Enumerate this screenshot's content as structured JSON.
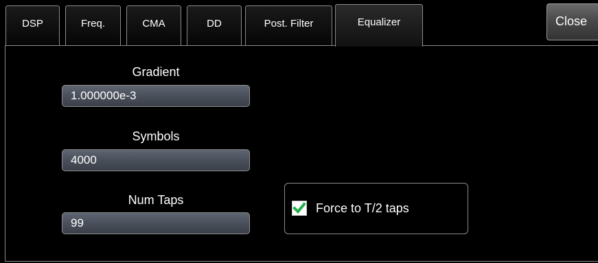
{
  "tabs": [
    {
      "label": "DSP"
    },
    {
      "label": "Freq."
    },
    {
      "label": "CMA"
    },
    {
      "label": "DD"
    },
    {
      "label": "Post. Filter"
    },
    {
      "label": "Equalizer",
      "active": true
    }
  ],
  "close_label": "Close",
  "fields": {
    "gradient": {
      "label": "Gradient",
      "value": "1.000000e-3"
    },
    "symbols": {
      "label": "Symbols",
      "value": "4000"
    },
    "num_taps": {
      "label": "Num Taps",
      "value": "99"
    }
  },
  "force_taps": {
    "label": "Force to T/2 taps",
    "checked": true,
    "check_color": "#22b14c"
  },
  "colors": {
    "background": "#000000",
    "input_fill": "#4a505b",
    "border": "#8c8c8c",
    "text": "#ffffff"
  }
}
